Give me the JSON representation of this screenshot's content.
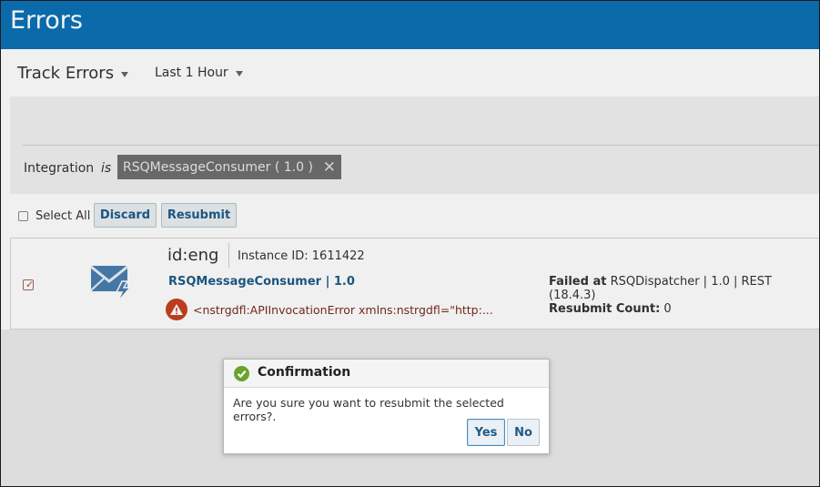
{
  "header": {
    "title": "Errors"
  },
  "toolbar": {
    "view_dropdown": "Track Errors",
    "time_dropdown": "Last 1 Hour"
  },
  "filter": {
    "label": "Integration",
    "operator": "is",
    "chip_value": "RSQMessageConsumer ( 1.0 )"
  },
  "actions": {
    "select_all_label": "Select All",
    "discard_label": "Discard",
    "resubmit_label": "Resubmit"
  },
  "error_row": {
    "checked": true,
    "name": "id:eng",
    "instance": "Instance ID: 1611422",
    "integration": "RSQMessageConsumer | 1.0",
    "message": "<nstrgdfl:APIInvocationError xmlns:nstrgdfl=\"http:...",
    "failed_at_label": "Failed at",
    "failed_at_value": "RSQDispatcher | 1.0 | REST (18.4.3)",
    "resubmit_count_label": "Resubmit Count:",
    "resubmit_count_value": "0",
    "icon": "envelope-lightning-icon"
  },
  "dialog": {
    "title": "Confirmation",
    "message": "Are you sure you want to resubmit the selected errors?.",
    "yes_label": "Yes",
    "no_label": "No"
  },
  "colors": {
    "header_bg": "#0b6aa9",
    "link": "#1e5b86",
    "error": "#c7411f",
    "success": "#6aa32e"
  }
}
